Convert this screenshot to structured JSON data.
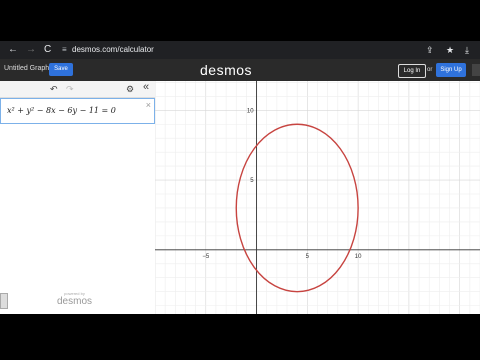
{
  "browser": {
    "back_glyph": "←",
    "forward_glyph": "→",
    "reload_glyph": "C",
    "site_info_glyph": "≡",
    "url": "desmos.com/calculator",
    "cast_glyph": "⇪",
    "bookmark_glyph": "★",
    "download_glyph": "⤓"
  },
  "app": {
    "graph_title": "Untitled Graph",
    "save_label": "Save",
    "logo": "desmos",
    "login_label": "Log In",
    "or_label": "or",
    "signup_label": "Sign Up"
  },
  "toolbar": {
    "undo_glyph": "↶",
    "redo_glyph": "↷",
    "settings_glyph": "⚙",
    "collapse_glyph": "«"
  },
  "expressions": [
    {
      "latex": "x² + y² − 8x − 6y − 11 = 0",
      "color": "#c74440"
    }
  ],
  "panel_footer": {
    "powered_by": "powered by",
    "brand": "desmos"
  },
  "graph": {
    "x_range": [
      -10,
      22
    ],
    "y_range": [
      -4.6,
      12.1
    ],
    "x_ticks": [
      -5,
      5,
      10
    ],
    "y_ticks": [
      5,
      10
    ],
    "circle": {
      "center_x": 4,
      "center_y": 3,
      "radius": 6,
      "color": "#c74440"
    }
  }
}
